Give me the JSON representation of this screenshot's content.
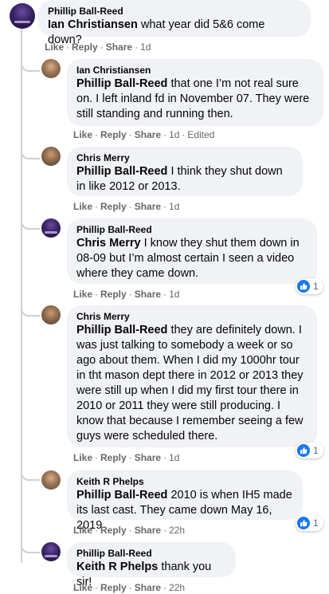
{
  "action_labels": {
    "like": "Like",
    "reply": "Reply",
    "share": "Share"
  },
  "comments": [
    {
      "author": "Phillip Ball-Reed",
      "mention": "Ian Christiansen",
      "text": " what year did 5&6 come down?",
      "timestamp": "1d",
      "edited": "",
      "reaction_count": ""
    },
    {
      "author": "Ian Christiansen",
      "mention": "Phillip Ball-Reed",
      "text": " that one I’m not real sure on. I left inland fd in November 07. They were still standing and running then.",
      "timestamp": "1d",
      "edited": "Edited",
      "reaction_count": ""
    },
    {
      "author": "Chris Merry",
      "mention": "Phillip Ball-Reed",
      "text": " I think they shut down in like 2012 or 2013.",
      "timestamp": "1d",
      "edited": "",
      "reaction_count": ""
    },
    {
      "author": "Phillip Ball-Reed",
      "mention": "Chris Merry",
      "text": " I know they shut them down in 08-09 but I’m almost certain I seen a video where they came down.",
      "timestamp": "1d",
      "edited": "",
      "reaction_count": "1"
    },
    {
      "author": "Chris Merry",
      "mention": "Phillip Ball-Reed",
      "text": " they are definitely down. I was just talking to somebody a week or so ago about them. When I did my 1000hr tour in tht mason dept there in 2012 or 2013 they were still up when I did my first tour there in 2010 or 2011 they were still producing. I know that because I remember seeing a few guys were scheduled there.",
      "timestamp": "1d",
      "edited": "",
      "reaction_count": "1"
    },
    {
      "author": "Keith R Phelps",
      "mention": "Phillip Ball-Reed",
      "text": " 2010 is when IH5 made its last cast. They came down May 16, 2019",
      "timestamp": "22h",
      "edited": "",
      "reaction_count": "1"
    },
    {
      "author": "Phillip Ball-Reed",
      "mention": "Keith R Phelps",
      "text": " thank you sir!",
      "timestamp": "22h",
      "edited": "",
      "reaction_count": ""
    }
  ]
}
